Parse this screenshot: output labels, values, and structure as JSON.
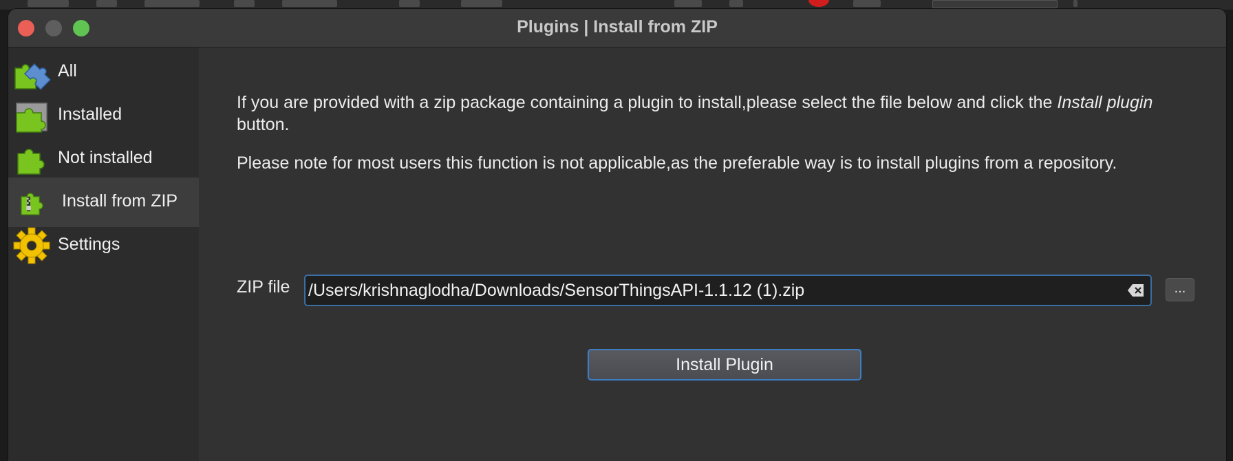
{
  "window": {
    "title": "Plugins | Install from ZIP"
  },
  "sidebar": {
    "items": [
      {
        "label": "All",
        "icon": "puzzle-all-icon"
      },
      {
        "label": "Installed",
        "icon": "puzzle-installed-icon"
      },
      {
        "label": "Not installed",
        "icon": "puzzle-not-installed-icon"
      },
      {
        "label": "Install from ZIP",
        "icon": "puzzle-zip-icon",
        "active": true
      },
      {
        "label": "Settings",
        "icon": "gear-icon"
      }
    ]
  },
  "main": {
    "intro_part1": "If you are provided with a zip package containing a plugin to install,please select the file below and click the ",
    "intro_emph": "Install plugin",
    "intro_part2": " button.",
    "note": "Please note for most users this function is not applicable,as the preferable way is to install plugins from a repository.",
    "zip_label": "ZIP file",
    "zip_value": "/Users/krishnaglodha/Downloads/SensorThingsAPI-1.1.12 (1).zip",
    "browse_label": "...",
    "install_label": "Install Plugin"
  },
  "colors": {
    "accent": "#3d7fc4",
    "puzzle_green": "#7ac41f",
    "puzzle_blue": "#5d8fd0",
    "gear_yellow": "#f2c200"
  }
}
